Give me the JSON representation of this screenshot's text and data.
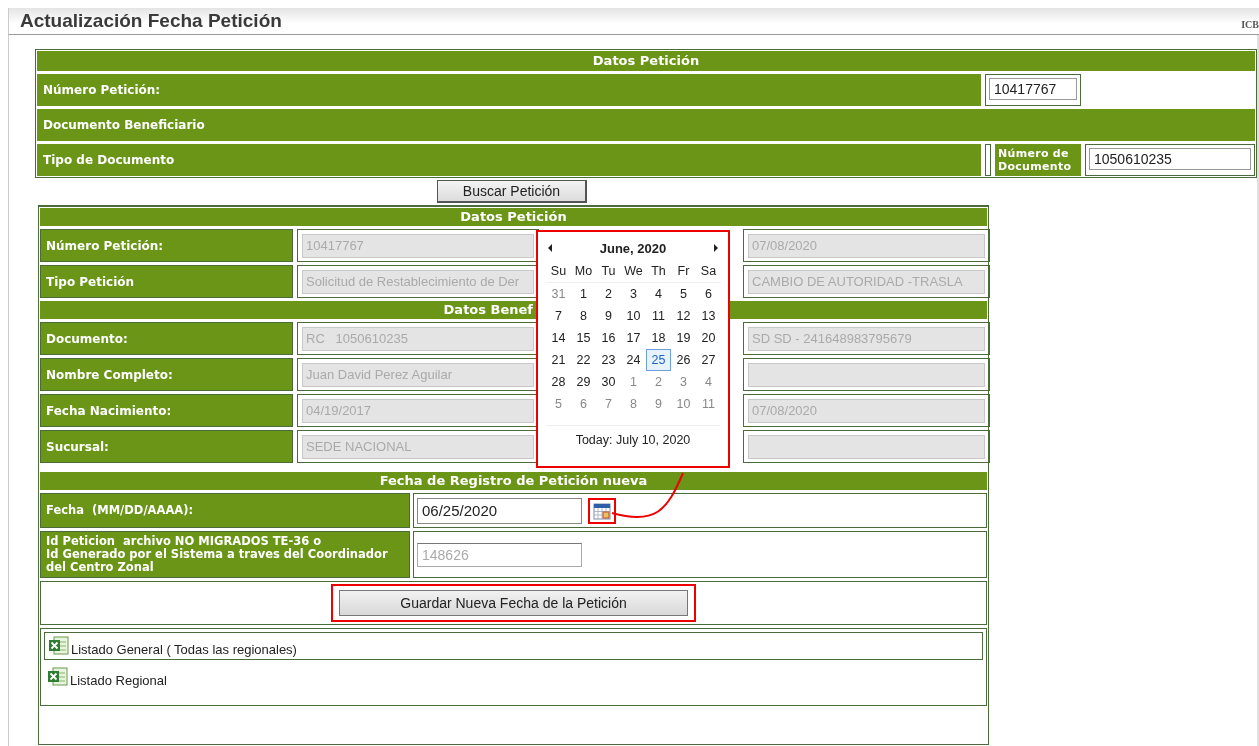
{
  "page_title": "Actualización Fecha Petición",
  "corner_text": "ICB",
  "search_form": {
    "title": "Datos Petición",
    "numero_peticion": {
      "label": "Número Petición:",
      "value": "10417767"
    },
    "documento_beneficiario": "Documento Beneficiario",
    "tipo_documento": "Tipo de Documento",
    "numero_documento": {
      "label": "Número de Documento",
      "value": "1050610235"
    },
    "search_button": "Buscar Petición"
  },
  "details": [
    {
      "title": "Datos Petición",
      "kind": "full",
      "rows": [
        {
          "label": "Número Petición:",
          "value": "10417767",
          "value_2": "07/08/2020"
        },
        {
          "label": "Tipo Petición",
          "value": "Solicitud de Restablecimiento de Der",
          "value_2": "CAMBIO DE AUTORIDAD -TRASLA"
        }
      ]
    },
    {
      "title": "Datos Benef",
      "kind": "cut",
      "rows": [
        {
          "label": "Documento:",
          "value": "RC   1050610235",
          "value_2": "SD SD - 241648983795679"
        },
        {
          "label": "Nombre Completo:",
          "value": "Juan David Perez Aguilar"
        },
        {
          "label": "Fecha Nacimiento:",
          "value": "04/19/2017",
          "value_2": "07/08/2020"
        },
        {
          "label": "Sucursal:",
          "value": "SEDE NACIONAL"
        }
      ]
    }
  ],
  "new_date": {
    "title": "Fecha de Registro de Petición nueva",
    "date_label": "Fecha  (MM/DD/AAAA):",
    "date_value": "06/25/2020",
    "id_label": [
      "Id Peticion  archivo NO MIGRADOS TE-36 o",
      "Id Generado por el Sistema a traves del Coordinador",
      "del Centro Zonal"
    ],
    "id_value": "148626",
    "save_button": "Guardar Nueva Fecha de la Petición"
  },
  "downloads": [
    "Listado General ( Todas las regionales)",
    "Listado Regional"
  ],
  "date_picker": {
    "month": "June, 2020",
    "weekdays": [
      "Su",
      "Mo",
      "Tu",
      "We",
      "Th",
      "Fr",
      "Sa"
    ],
    "weeks": [
      [
        {
          "day": "31",
          "other_month": true,
          "selected": false
        },
        {
          "day": "1",
          "other_month": false,
          "selected": false
        },
        {
          "day": "2",
          "other_month": false,
          "selected": false
        },
        {
          "day": "3",
          "other_month": false,
          "selected": false
        },
        {
          "day": "4",
          "other_month": false,
          "selected": false
        },
        {
          "day": "5",
          "other_month": false,
          "selected": false
        },
        {
          "day": "6",
          "other_month": false,
          "selected": false
        }
      ],
      [
        {
          "day": "7",
          "other_month": false,
          "selected": false
        },
        {
          "day": "8",
          "other_month": false,
          "selected": false
        },
        {
          "day": "9",
          "other_month": false,
          "selected": false
        },
        {
          "day": "10",
          "other_month": false,
          "selected": false
        },
        {
          "day": "11",
          "other_month": false,
          "selected": false
        },
        {
          "day": "12",
          "other_month": false,
          "selected": false
        },
        {
          "day": "13",
          "other_month": false,
          "selected": false
        }
      ],
      [
        {
          "day": "14",
          "other_month": false,
          "selected": false
        },
        {
          "day": "15",
          "other_month": false,
          "selected": false
        },
        {
          "day": "16",
          "other_month": false,
          "selected": false
        },
        {
          "day": "17",
          "other_month": false,
          "selected": false
        },
        {
          "day": "18",
          "other_month": false,
          "selected": false
        },
        {
          "day": "19",
          "other_month": false,
          "selected": false
        },
        {
          "day": "20",
          "other_month": false,
          "selected": false
        }
      ],
      [
        {
          "day": "21",
          "other_month": false,
          "selected": false
        },
        {
          "day": "22",
          "other_month": false,
          "selected": false
        },
        {
          "day": "23",
          "other_month": false,
          "selected": false
        },
        {
          "day": "24",
          "other_month": false,
          "selected": false
        },
        {
          "day": "25",
          "other_month": false,
          "selected": true
        },
        {
          "day": "26",
          "other_month": false,
          "selected": false
        },
        {
          "day": "27",
          "other_month": false,
          "selected": false
        }
      ],
      [
        {
          "day": "28",
          "other_month": false,
          "selected": false
        },
        {
          "day": "29",
          "other_month": false,
          "selected": false
        },
        {
          "day": "30",
          "other_month": false,
          "selected": false
        },
        {
          "day": "1",
          "other_month": true,
          "selected": false
        },
        {
          "day": "2",
          "other_month": true,
          "selected": false
        },
        {
          "day": "3",
          "other_month": true,
          "selected": false
        },
        {
          "day": "4",
          "other_month": true,
          "selected": false
        }
      ],
      [
        {
          "day": "5",
          "other_month": true,
          "selected": false
        },
        {
          "day": "6",
          "other_month": true,
          "selected": false
        },
        {
          "day": "7",
          "other_month": true,
          "selected": false
        },
        {
          "day": "8",
          "other_month": true,
          "selected": false
        },
        {
          "day": "9",
          "other_month": true,
          "selected": false
        },
        {
          "day": "10",
          "other_month": true,
          "selected": false
        },
        {
          "day": "11",
          "other_month": true,
          "selected": false
        }
      ]
    ],
    "today": "Today: July 10, 2020"
  }
}
